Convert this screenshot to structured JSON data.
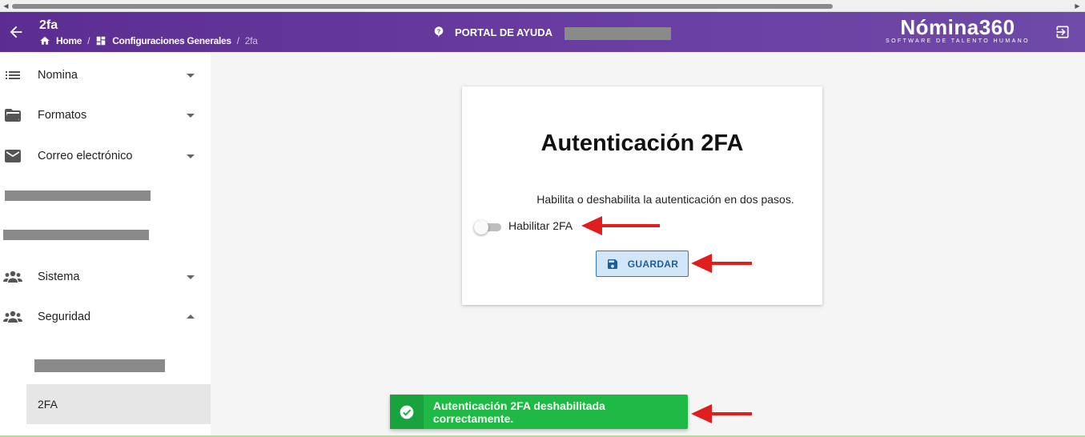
{
  "header": {
    "page_title": "2fa",
    "breadcrumb": [
      {
        "label": "Home",
        "icon": "home-icon"
      },
      {
        "label": "Configuraciones Generales",
        "icon": "dashboard-icon"
      },
      {
        "label": "2fa"
      }
    ],
    "help_label": "PORTAL DE AYUDA",
    "brand_name": "Nómina360",
    "brand_tagline": "SOFTWARE DE TALENTO HUMANO"
  },
  "sidebar": {
    "items": [
      {
        "label": "Nomina",
        "icon": "list-icon",
        "expanded": false
      },
      {
        "label": "Formatos",
        "icon": "folder-open-icon",
        "expanded": false
      },
      {
        "label": "Correo electrónico",
        "icon": "mail-icon",
        "expanded": false
      },
      {
        "label": "Sistema",
        "icon": "people-icon",
        "expanded": false
      },
      {
        "label": "Seguridad",
        "icon": "people-icon",
        "expanded": true
      }
    ],
    "active_subitem": "2FA"
  },
  "card": {
    "title": "Autenticación 2FA",
    "description": "Habilita o deshabilita la autenticación en dos pasos.",
    "toggle_label": "Habilitar 2FA",
    "toggle_enabled": false,
    "save_label": "GUARDAR"
  },
  "toast": {
    "message": "Autenticación 2FA deshabilitada correctamente.",
    "color": "#1fba45"
  },
  "colors": {
    "header": "#5b2d91",
    "annotation_arrow": "#e01e1e"
  }
}
